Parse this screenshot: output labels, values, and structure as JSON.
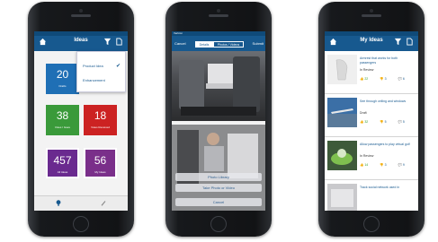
{
  "phones": {
    "dashboard": {
      "title": "Ideas",
      "dropdown": {
        "option1": "Product Idea",
        "option2": "Enhancement"
      },
      "tiles": [
        {
          "num": "20",
          "label": "Drafts",
          "color": "#1f6fb5"
        },
        {
          "num": "38",
          "label": "Votes I Gave",
          "color": "#3a9a3a"
        },
        {
          "num": "18",
          "label": "Votes Received",
          "color": "#cc2222"
        },
        {
          "num": "457",
          "label": "All Ideas",
          "color": "#6a2a8f"
        },
        {
          "num": "56",
          "label": "My Ideas",
          "color": "#7a2f8a"
        }
      ]
    },
    "submit": {
      "status": "Verizon",
      "cancel": "Cancel",
      "submit": "Submit",
      "seg1": "Details",
      "seg2": "Photos / Videos",
      "sheet1": "Photo Library",
      "sheet2": "Take Photo or Video",
      "sheet3": "Cancel"
    },
    "myideas": {
      "title": "My Ideas",
      "items": [
        {
          "title": "Armrest that works for both passengers",
          "status": "In Review",
          "up": "22",
          "down": "3",
          "comments": "6"
        },
        {
          "title": "See through ceiling and windows",
          "status": "Draft",
          "up": "32",
          "down": "5",
          "comments": "5"
        },
        {
          "title": "Allow passengers to play virtual golf",
          "status": "In Review",
          "up": "14",
          "down": "3",
          "comments": "9"
        },
        {
          "title": "Track social network used in",
          "status": "",
          "up": "",
          "down": "",
          "comments": ""
        }
      ]
    }
  }
}
